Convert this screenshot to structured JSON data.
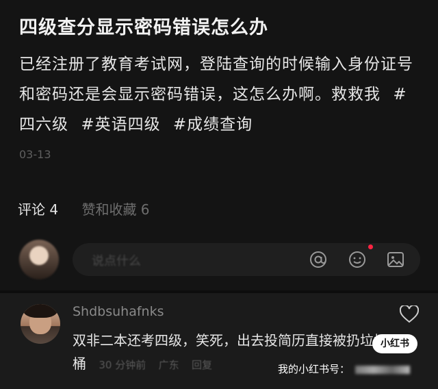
{
  "post": {
    "title": "四级查分显示密码错误怎么办",
    "body": "已经注册了教育考试网，登陆查询的时候输入身份证号和密码还是会显示密码错误，这怎么办啊。救救我",
    "tags": [
      "#四六级",
      "#英语四级",
      "#成绩查询"
    ],
    "date": "03-13"
  },
  "stats": {
    "comments_label": "评论 4",
    "likes_label": "赞和收藏 6"
  },
  "input": {
    "placeholder": "说点什么"
  },
  "comment": {
    "username": "Shdbsuhafnks",
    "text": "双非二本还考四级，笑死，出去投简历直接被扔垃圾桶",
    "time": "30 分钟前",
    "location": "广东",
    "reply_label": "回复"
  },
  "watermark": {
    "brand": "小红书",
    "id_label": "我的小红书号："
  },
  "colors": {
    "background": "#141414",
    "accent_red": "#ff2442"
  }
}
